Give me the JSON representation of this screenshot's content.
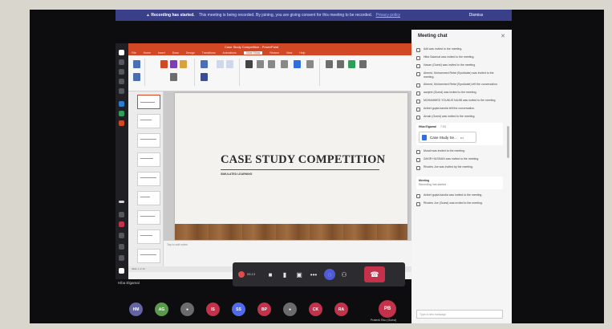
{
  "notice": {
    "title": "Recording has started.",
    "text": "This meeting is being recorded. By joining, you are giving consent for this meeting to be recorded.",
    "policy": "Privacy policy",
    "dismiss": "Dismiss"
  },
  "powerpoint": {
    "title": "Case Study Competition - PowerPoint",
    "tabs": [
      "File",
      "Home",
      "Insert",
      "Draw",
      "Design",
      "Transitions",
      "Animations",
      "Slide Show",
      "Review",
      "View",
      "Help"
    ],
    "active_tab": "Slide Show",
    "slide_title": "CASE STUDY COMPETITION",
    "slide_subtitle": "SIMULATED LEARNING",
    "notes_placeholder": "Tap to add notes",
    "status": "Slide 1 of 12"
  },
  "controls": {
    "timer": "05:13"
  },
  "presenter": "Hiba Elgamal",
  "participants": [
    {
      "initials": "HM",
      "color": "#6264a7"
    },
    {
      "initials": "AG",
      "color": "#5a9b4a"
    },
    {
      "initials": "",
      "color": "#6b6b6b"
    },
    {
      "initials": "IS",
      "color": "#c4314b"
    },
    {
      "initials": "SS",
      "color": "#4f6bed"
    },
    {
      "initials": "BP",
      "color": "#c4314b"
    },
    {
      "initials": "",
      "color": "#6b6b6b"
    },
    {
      "initials": "CK",
      "color": "#c4314b"
    },
    {
      "initials": "RA",
      "color": "#c4314b"
    }
  ],
  "big_participant": {
    "initials": "PB",
    "color": "#c4314b",
    "name": "Prateek Rao (Guest)"
  },
  "chat": {
    "title": "Meeting chat",
    "messages": [
      "Adil was invited to the meeting.",
      "Hiba Salamat was invited to the meeting.",
      "Hasan (Guest) was invited to the meeting.",
      "Ahmed, Mohammed Refat (Syndicate) was invited to the meeting.",
      "Ahmed, Mohammed Refat (Syndicate) left the conversation.",
      "aanjeet (Guest) was invited to the meeting.",
      "MOHAMMED YOUNUS NAJIB was invited to the meeting.",
      "Aniket gupta karotia left the conversation.",
      "Arnab (Guest) was invited to the meeting."
    ],
    "post_author": "Hiba Elgamal",
    "post_time": "7:03",
    "attachment": "Case Study Se...",
    "messages_after": [
      "Murali was invited to the meeting.",
      "ZAKIR HUSSAIN was invited to the meeting.",
      "Rhodes Joe was invited by the meeting."
    ],
    "meeting_card_title": "Meeting",
    "meeting_card_sub": "Recording has started",
    "messages_end": [
      "Aniket gupta karotia was invited to the meeting.",
      "Rhodes Joe (Guest) was invited to the meeting."
    ],
    "input_placeholder": "Type a new message"
  }
}
